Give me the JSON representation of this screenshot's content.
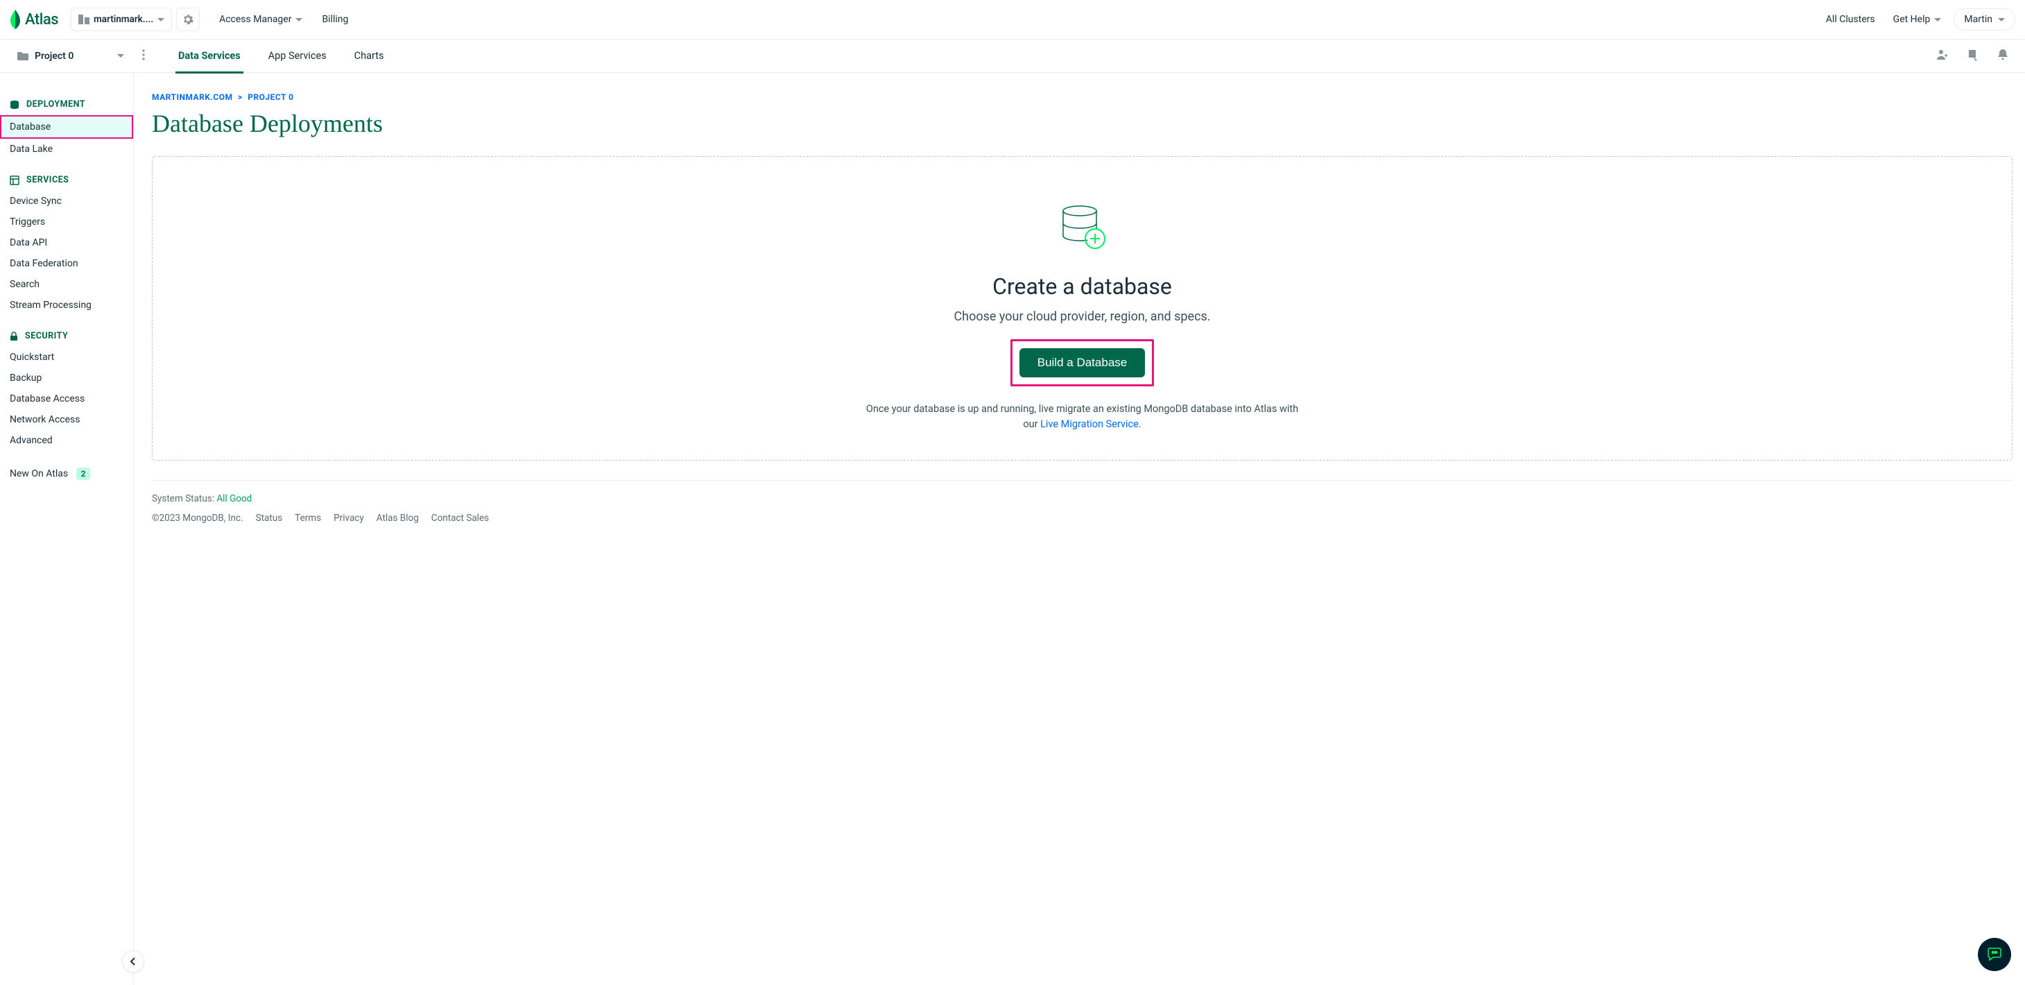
{
  "brand": "Atlas",
  "org_selector_label": "martinmark....",
  "top_nav": {
    "access_manager": "Access Manager",
    "billing": "Billing",
    "all_clusters": "All Clusters",
    "get_help": "Get Help"
  },
  "user_name": "Martin",
  "project_name": "Project 0",
  "tabs": {
    "data_services": "Data Services",
    "app_services": "App Services",
    "charts": "Charts"
  },
  "sidebar": {
    "deployment_header": "DEPLOYMENT",
    "deployment_items": [
      "Database",
      "Data Lake"
    ],
    "services_header": "SERVICES",
    "services_items": [
      "Device Sync",
      "Triggers",
      "Data API",
      "Data Federation",
      "Search",
      "Stream Processing"
    ],
    "security_header": "SECURITY",
    "security_items": [
      "Quickstart",
      "Backup",
      "Database Access",
      "Network Access",
      "Advanced"
    ],
    "new_on_atlas": "New On Atlas",
    "new_count": "2"
  },
  "breadcrumb": {
    "org": "MARTINMARK.COM",
    "sep": ">",
    "project": "PROJECT 0"
  },
  "page_title": "Database Deployments",
  "empty": {
    "heading": "Create a database",
    "sub": "Choose your cloud provider, region, and specs.",
    "button": "Build a Database",
    "post1": "Once your database is up and running, live migrate an existing MongoDB database into Atlas with our ",
    "link": "Live Migration Service."
  },
  "status_label": "System Status: ",
  "status_value": "All Good",
  "footer": {
    "copyright": "©2023 MongoDB, Inc.",
    "links": [
      "Status",
      "Terms",
      "Privacy",
      "Atlas Blog",
      "Contact Sales"
    ]
  }
}
